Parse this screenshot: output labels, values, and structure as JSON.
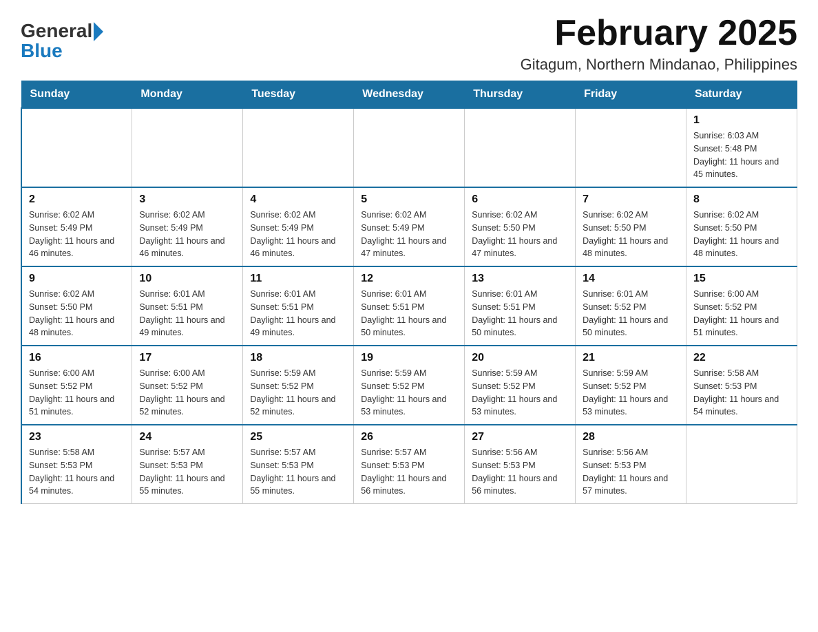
{
  "logo": {
    "general": "General",
    "blue": "Blue"
  },
  "title": "February 2025",
  "subtitle": "Gitagum, Northern Mindanao, Philippines",
  "days_of_week": [
    "Sunday",
    "Monday",
    "Tuesday",
    "Wednesday",
    "Thursday",
    "Friday",
    "Saturday"
  ],
  "weeks": [
    [
      {
        "day": "",
        "info": ""
      },
      {
        "day": "",
        "info": ""
      },
      {
        "day": "",
        "info": ""
      },
      {
        "day": "",
        "info": ""
      },
      {
        "day": "",
        "info": ""
      },
      {
        "day": "",
        "info": ""
      },
      {
        "day": "1",
        "info": "Sunrise: 6:03 AM\nSunset: 5:48 PM\nDaylight: 11 hours and 45 minutes."
      }
    ],
    [
      {
        "day": "2",
        "info": "Sunrise: 6:02 AM\nSunset: 5:49 PM\nDaylight: 11 hours and 46 minutes."
      },
      {
        "day": "3",
        "info": "Sunrise: 6:02 AM\nSunset: 5:49 PM\nDaylight: 11 hours and 46 minutes."
      },
      {
        "day": "4",
        "info": "Sunrise: 6:02 AM\nSunset: 5:49 PM\nDaylight: 11 hours and 46 minutes."
      },
      {
        "day": "5",
        "info": "Sunrise: 6:02 AM\nSunset: 5:49 PM\nDaylight: 11 hours and 47 minutes."
      },
      {
        "day": "6",
        "info": "Sunrise: 6:02 AM\nSunset: 5:50 PM\nDaylight: 11 hours and 47 minutes."
      },
      {
        "day": "7",
        "info": "Sunrise: 6:02 AM\nSunset: 5:50 PM\nDaylight: 11 hours and 48 minutes."
      },
      {
        "day": "8",
        "info": "Sunrise: 6:02 AM\nSunset: 5:50 PM\nDaylight: 11 hours and 48 minutes."
      }
    ],
    [
      {
        "day": "9",
        "info": "Sunrise: 6:02 AM\nSunset: 5:50 PM\nDaylight: 11 hours and 48 minutes."
      },
      {
        "day": "10",
        "info": "Sunrise: 6:01 AM\nSunset: 5:51 PM\nDaylight: 11 hours and 49 minutes."
      },
      {
        "day": "11",
        "info": "Sunrise: 6:01 AM\nSunset: 5:51 PM\nDaylight: 11 hours and 49 minutes."
      },
      {
        "day": "12",
        "info": "Sunrise: 6:01 AM\nSunset: 5:51 PM\nDaylight: 11 hours and 50 minutes."
      },
      {
        "day": "13",
        "info": "Sunrise: 6:01 AM\nSunset: 5:51 PM\nDaylight: 11 hours and 50 minutes."
      },
      {
        "day": "14",
        "info": "Sunrise: 6:01 AM\nSunset: 5:52 PM\nDaylight: 11 hours and 50 minutes."
      },
      {
        "day": "15",
        "info": "Sunrise: 6:00 AM\nSunset: 5:52 PM\nDaylight: 11 hours and 51 minutes."
      }
    ],
    [
      {
        "day": "16",
        "info": "Sunrise: 6:00 AM\nSunset: 5:52 PM\nDaylight: 11 hours and 51 minutes."
      },
      {
        "day": "17",
        "info": "Sunrise: 6:00 AM\nSunset: 5:52 PM\nDaylight: 11 hours and 52 minutes."
      },
      {
        "day": "18",
        "info": "Sunrise: 5:59 AM\nSunset: 5:52 PM\nDaylight: 11 hours and 52 minutes."
      },
      {
        "day": "19",
        "info": "Sunrise: 5:59 AM\nSunset: 5:52 PM\nDaylight: 11 hours and 53 minutes."
      },
      {
        "day": "20",
        "info": "Sunrise: 5:59 AM\nSunset: 5:52 PM\nDaylight: 11 hours and 53 minutes."
      },
      {
        "day": "21",
        "info": "Sunrise: 5:59 AM\nSunset: 5:52 PM\nDaylight: 11 hours and 53 minutes."
      },
      {
        "day": "22",
        "info": "Sunrise: 5:58 AM\nSunset: 5:53 PM\nDaylight: 11 hours and 54 minutes."
      }
    ],
    [
      {
        "day": "23",
        "info": "Sunrise: 5:58 AM\nSunset: 5:53 PM\nDaylight: 11 hours and 54 minutes."
      },
      {
        "day": "24",
        "info": "Sunrise: 5:57 AM\nSunset: 5:53 PM\nDaylight: 11 hours and 55 minutes."
      },
      {
        "day": "25",
        "info": "Sunrise: 5:57 AM\nSunset: 5:53 PM\nDaylight: 11 hours and 55 minutes."
      },
      {
        "day": "26",
        "info": "Sunrise: 5:57 AM\nSunset: 5:53 PM\nDaylight: 11 hours and 56 minutes."
      },
      {
        "day": "27",
        "info": "Sunrise: 5:56 AM\nSunset: 5:53 PM\nDaylight: 11 hours and 56 minutes."
      },
      {
        "day": "28",
        "info": "Sunrise: 5:56 AM\nSunset: 5:53 PM\nDaylight: 11 hours and 57 minutes."
      },
      {
        "day": "",
        "info": ""
      }
    ]
  ]
}
